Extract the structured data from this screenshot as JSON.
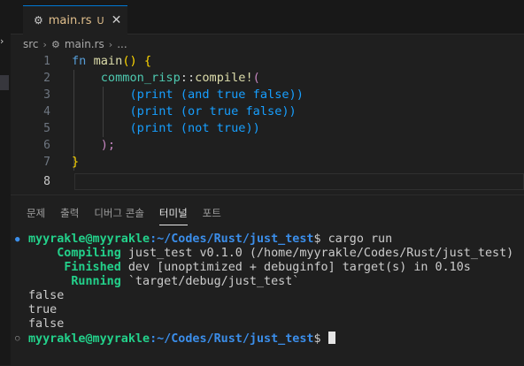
{
  "tab": {
    "filename": "main.rs",
    "status": "U",
    "close": "✕"
  },
  "breadcrumb": {
    "folder": "src",
    "file": "main.rs",
    "more": "..."
  },
  "editor": {
    "line_numbers": [
      "1",
      "2",
      "3",
      "4",
      "5",
      "6",
      "7",
      "8"
    ],
    "lines": [
      [
        "fn",
        "main",
        "()",
        "{"
      ],
      [
        "common_risp",
        "::",
        "compile!",
        "("
      ],
      [
        "(print",
        "(and",
        "true false))"
      ],
      [
        "(print",
        "(or",
        "true false))"
      ],
      [
        "(print",
        "(not",
        "true))"
      ],
      [
        ");"
      ],
      [
        "}"
      ],
      []
    ]
  },
  "panel": {
    "tabs": [
      "문제",
      "출력",
      "디버그 콘솔",
      "터미널",
      "포트"
    ],
    "active_tab": "터미널"
  },
  "terminal": {
    "prompt_user": "myyrakle@myyrakle",
    "prompt_path": ":~/Codes/Rust/just_test",
    "prompt_symbol": "$",
    "command": " cargo run",
    "compiling_label": "Compiling",
    "compiling_text": " just_test v0.1.0 (/home/myyrakle/Codes/Rust/just_test)",
    "finished_label": "Finished",
    "finished_text": " dev [unoptimized + debuginfo] target(s) in 0.10s",
    "running_label": "Running",
    "running_text": " `target/debug/just_test`",
    "outputs": [
      "false",
      "true",
      "false"
    ],
    "second_prompt_user": "myyrakle@myyrakle",
    "second_prompt_path": ":~/Codes/Rust/just_test",
    "second_prompt_symbol": "$"
  },
  "colors": {
    "accent": "#0078d4",
    "terminal_green": "#23d18b",
    "terminal_blue": "#3b8eea"
  }
}
